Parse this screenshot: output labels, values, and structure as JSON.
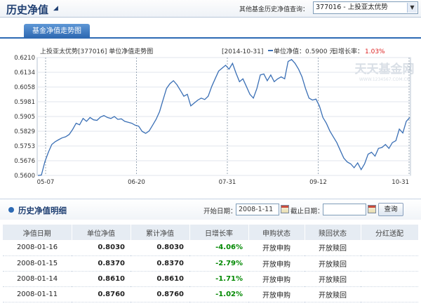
{
  "header": {
    "title": "历史净值",
    "other_label": "其他基金历史净值查询：",
    "fund_select_value": "377016 - 上投亚太优势"
  },
  "tabs": [
    {
      "label": "基金净值走势图"
    }
  ],
  "chart": {
    "info_left": "上投亚太优势[377016] 单位净值走势图",
    "info_date": "[2014-10-31]",
    "info_nav_label": "单位净值：0.5900 元",
    "info_growth_label": "日增长率：",
    "info_growth_value": "1.03%",
    "watermark": "天天基金网",
    "watermark_sub": "WWW.1234567.COM.CN"
  },
  "chart_data": {
    "type": "line",
    "title": "上投亚太优势[377016] 单位净值走势图",
    "x_ticks": [
      "05-07",
      "06-20",
      "07-31",
      "09-12",
      "10-31"
    ],
    "y_ticks": [
      "0.6210",
      "0.6134",
      "0.6058",
      "0.5981",
      "0.5905",
      "0.5829",
      "0.5753",
      "0.5676",
      "0.5600"
    ],
    "ylim": [
      0.56,
      0.621
    ],
    "grid": true,
    "series": [
      {
        "name": "单位净值",
        "color": "#3a6fb5",
        "values": [
          0.56,
          0.5602,
          0.567,
          0.572,
          0.576,
          0.5775,
          0.5785,
          0.5795,
          0.58,
          0.5812,
          0.5838,
          0.587,
          0.5862,
          0.5895,
          0.588,
          0.59,
          0.5888,
          0.5885,
          0.5902,
          0.591,
          0.59,
          0.5895,
          0.5905,
          0.589,
          0.5893,
          0.588,
          0.5875,
          0.587,
          0.586,
          0.5855,
          0.5828,
          0.5818,
          0.583,
          0.586,
          0.589,
          0.593,
          0.599,
          0.605,
          0.6075,
          0.609,
          0.607,
          0.604,
          0.601,
          0.602,
          0.596,
          0.5975,
          0.599,
          0.6,
          0.5993,
          0.601,
          0.606,
          0.61,
          0.614,
          0.6155,
          0.617,
          0.615,
          0.618,
          0.613,
          0.6085,
          0.61,
          0.606,
          0.602,
          0.6,
          0.605,
          0.612,
          0.6125,
          0.609,
          0.612,
          0.6085,
          0.61,
          0.611,
          0.61,
          0.619,
          0.62,
          0.618,
          0.615,
          0.611,
          0.605,
          0.6,
          0.599,
          0.5995,
          0.596,
          0.59,
          0.587,
          0.583,
          0.58,
          0.577,
          0.573,
          0.569,
          0.567,
          0.566,
          0.564,
          0.5665,
          0.563,
          0.566,
          0.571,
          0.572,
          0.57,
          0.574,
          0.5745,
          0.576,
          0.574,
          0.577,
          0.578,
          0.584,
          0.582,
          0.588,
          0.59
        ]
      }
    ]
  },
  "history": {
    "title": "历史净值明细",
    "start_label": "开始日期：",
    "start_value": "2008-1-11",
    "end_label": "截止日期：",
    "end_value": "",
    "query_label": "查询",
    "columns": [
      "净值日期",
      "单位净值",
      "累计净值",
      "日增长率",
      "申购状态",
      "赎回状态",
      "分红送配"
    ],
    "rows": [
      {
        "date": "2008-01-16",
        "nav": "0.8030",
        "acc": "0.8030",
        "growth": "-4.06%",
        "buy": "开放申购",
        "redeem": "开放赎回",
        "div": ""
      },
      {
        "date": "2008-01-15",
        "nav": "0.8370",
        "acc": "0.8370",
        "growth": "-2.79%",
        "buy": "开放申购",
        "redeem": "开放赎回",
        "div": ""
      },
      {
        "date": "2008-01-14",
        "nav": "0.8610",
        "acc": "0.8610",
        "growth": "-1.71%",
        "buy": "开放申购",
        "redeem": "开放赎回",
        "div": ""
      },
      {
        "date": "2008-01-11",
        "nav": "0.8760",
        "acc": "0.8760",
        "growth": "-1.02%",
        "buy": "开放申购",
        "redeem": "开放赎回",
        "div": ""
      }
    ]
  }
}
